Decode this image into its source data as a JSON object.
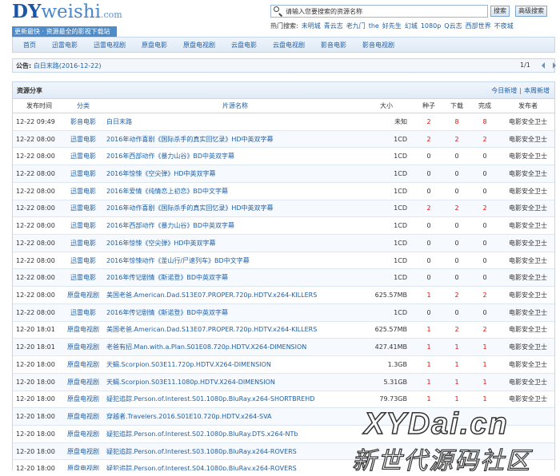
{
  "logo": {
    "dy": "DY",
    "rest": "weishi",
    "domain": ".com",
    "slogan": "更新最快 · 资源最全的影视下载站"
  },
  "search": {
    "placeholder": "请输入您要搜索的资源名称",
    "button_label": "搜索",
    "advanced_label": "高级搜索",
    "icon": "search-icon"
  },
  "hot": {
    "label": "热门搜索:",
    "items": [
      "未明城",
      "青云志",
      "老九门",
      "the",
      "好先生",
      "幻城",
      "1080p",
      "Q云志",
      "西部世界",
      "不夜城"
    ]
  },
  "nav": {
    "items": [
      "首页",
      "迅雷电影",
      "迅雷电视剧",
      "原盘电影",
      "原盘电视剧",
      "云盘电影",
      "云盘电视剧",
      "影音电影",
      "影音电视剧"
    ]
  },
  "notice": {
    "label": "公告:",
    "text": "白日末路(2016-12-22)",
    "pager": "1/1"
  },
  "panel": {
    "title": "资源分享",
    "link_today": "今日新增",
    "link_week": "本周新增"
  },
  "columns": [
    "发布时间",
    "分类",
    "片源名称",
    "大小",
    "种子",
    "下载",
    "完成",
    "发布者"
  ],
  "rows": [
    {
      "time": "12-22 09:49",
      "cat": "影音电影",
      "name": "白日末路",
      "size": "未知",
      "seed": "2",
      "dl": "8",
      "done": "8",
      "pub": "电影安全卫士"
    },
    {
      "time": "12-22 08:00",
      "cat": "迅雷电影",
      "name": "2016年动作喜剧《国际杀手的真实回忆录》HD中英双字幕",
      "size": "1CD",
      "seed": "2",
      "dl": "2",
      "done": "2",
      "pub": "电影安全卫士"
    },
    {
      "time": "12-22 08:00",
      "cat": "迅雷电影",
      "name": "2016年西部动作《暴力山谷》BD中英双字幕",
      "size": "1CD",
      "seed": "0",
      "dl": "0",
      "done": "0",
      "pub": "电影安全卫士"
    },
    {
      "time": "12-22 08:00",
      "cat": "迅雷电影",
      "name": "2016年惊悚《空尖弹》HD中英双字幕",
      "size": "1CD",
      "seed": "0",
      "dl": "0",
      "done": "0",
      "pub": "电影安全卫士"
    },
    {
      "time": "12-22 08:00",
      "cat": "迅雷电影",
      "name": "2016年爱情《纯情恋上初恋》BD中文字幕",
      "size": "1CD",
      "seed": "0",
      "dl": "0",
      "done": "0",
      "pub": "电影安全卫士"
    },
    {
      "time": "12-22 08:00",
      "cat": "迅雷电影",
      "name": "2016年动作喜剧《国际杀手的真实回忆录》HD中英双字幕",
      "size": "1CD",
      "seed": "2",
      "dl": "2",
      "done": "2",
      "pub": "电影安全卫士"
    },
    {
      "time": "12-22 08:00",
      "cat": "迅雷电影",
      "name": "2016年西部动作《暴力山谷》BD中英双字幕",
      "size": "1CD",
      "seed": "0",
      "dl": "0",
      "done": "0",
      "pub": "电影安全卫士"
    },
    {
      "time": "12-22 08:00",
      "cat": "迅雷电影",
      "name": "2016年惊悚《空尖弹》HD中英双字幕",
      "size": "1CD",
      "seed": "0",
      "dl": "0",
      "done": "0",
      "pub": "电影安全卫士"
    },
    {
      "time": "12-22 08:00",
      "cat": "迅雷电影",
      "name": "2016年惊悚动作《釜山行/尸速列车》BD中文字幕",
      "size": "1CD",
      "seed": "0",
      "dl": "0",
      "done": "0",
      "pub": "电影安全卫士"
    },
    {
      "time": "12-22 08:00",
      "cat": "迅雷电影",
      "name": "2016年传记剧情《斯诺登》BD中英双字幕",
      "size": "1CD",
      "seed": "0",
      "dl": "0",
      "done": "0",
      "pub": "电影安全卫士"
    },
    {
      "time": "12-22 08:00",
      "cat": "原盘电视剧",
      "name": "美国老爸.American.Dad.S13E07.PROPER.720p.HDTV.x264-KILLERS",
      "size": "625.57MB",
      "seed": "1",
      "dl": "2",
      "done": "2",
      "pub": "电影安全卫士"
    },
    {
      "time": "12-22 08:00",
      "cat": "迅雷电影",
      "name": "2016年传记剧情《斯诺登》BD中英双字幕",
      "size": "1CD",
      "seed": "0",
      "dl": "0",
      "done": "0",
      "pub": "电影安全卫士"
    },
    {
      "time": "12-20 18:01",
      "cat": "原盘电视剧",
      "name": "美国老爸.American.Dad.S13E07.PROPER.720p.HDTV.x264-KILLERS",
      "size": "625.57MB",
      "seed": "1",
      "dl": "2",
      "done": "2",
      "pub": "电影安全卫士"
    },
    {
      "time": "12-20 18:01",
      "cat": "原盘电视剧",
      "name": "老爸有招.Man.with.a.Plan.S01E08.720p.HDTV.X264-DIMENSION",
      "size": "427.41MB",
      "seed": "1",
      "dl": "1",
      "done": "1",
      "pub": "电影安全卫士"
    },
    {
      "time": "12-20 18:00",
      "cat": "原盘电视剧",
      "name": "天蝎.Scorpion.S03E11.720p.HDTV.X264-DIMENSION",
      "size": "1.3GB",
      "seed": "1",
      "dl": "1",
      "done": "1",
      "pub": "电影安全卫士"
    },
    {
      "time": "12-20 18:00",
      "cat": "原盘电视剧",
      "name": "天蝎.Scorpion.S03E11.1080p.HDTV.X264-DIMENSION",
      "size": "5.31GB",
      "seed": "1",
      "dl": "1",
      "done": "1",
      "pub": "电影安全卫士"
    },
    {
      "time": "12-20 18:00",
      "cat": "原盘电视剧",
      "name": "疑犯追踪.Person.of.Interest.S01.1080p.BluRay.x264-SHORTBREHD",
      "size": "79.73GB",
      "seed": "1",
      "dl": "1",
      "done": "1",
      "pub": "电影安全卫士"
    },
    {
      "time": "12-20 18:00",
      "cat": "原盘电视剧",
      "name": "穿越者.Travelers.2016.S01E10.720p.HDTV.x264-SVA",
      "size": "",
      "seed": "",
      "dl": "",
      "done": "",
      "pub": ""
    },
    {
      "time": "12-20 18:00",
      "cat": "原盘电视剧",
      "name": "疑犯追踪.Person.of.Interest.S02.1080p.BluRay.DTS.x264-NTb",
      "size": "",
      "seed": "",
      "dl": "",
      "done": "",
      "pub": ""
    },
    {
      "time": "12-20 18:00",
      "cat": "原盘电视剧",
      "name": "疑犯追踪.Person.of.Interest.S03.1080p.BluRay.x264-ROVERS",
      "size": "",
      "seed": "",
      "dl": "",
      "done": "",
      "pub": ""
    },
    {
      "time": "12-20 18:00",
      "cat": "原盘电视剧",
      "name": "疑犯追踪.Person.of.Interest.S04.1080p.BluRay.x264-ROVERS",
      "size": "",
      "seed": "",
      "dl": "",
      "done": "",
      "pub": ""
    }
  ],
  "watermark": {
    "line1": "XYDai.cn",
    "line2": "新世代源码社区"
  },
  "colors": {
    "link": "#1f5fa6",
    "accent": "#4d8cc9",
    "count_red": "#dd1111",
    "border": "#c4d7eb"
  }
}
